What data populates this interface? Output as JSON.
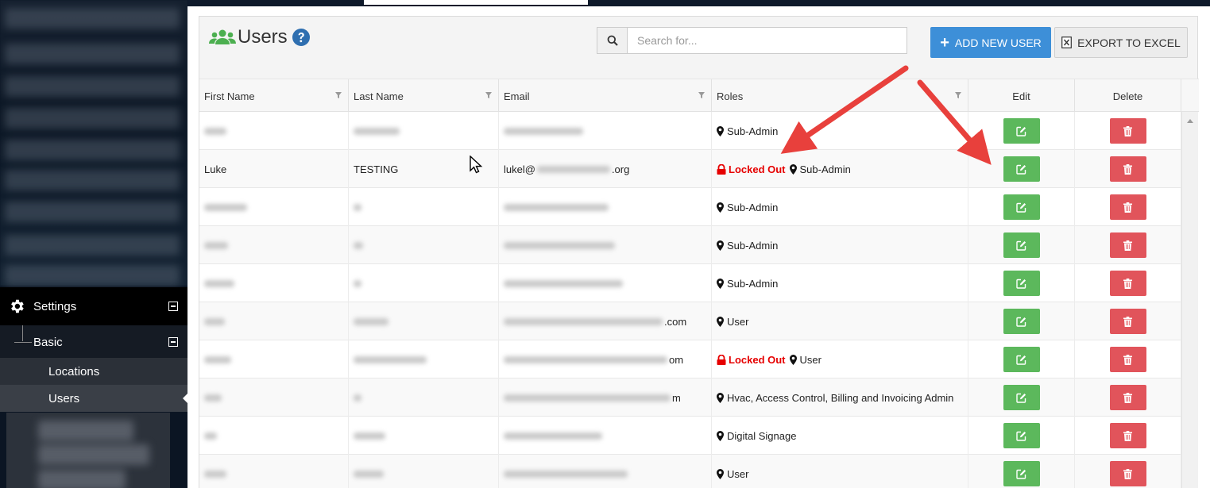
{
  "sidebar": {
    "settings_label": "Settings",
    "basic_label": "Basic",
    "locations_label": "Locations",
    "users_label": "Users"
  },
  "header": {
    "title": "Users",
    "search_placeholder": "Search for...",
    "add_button_label": "ADD NEW USER",
    "export_button_label": "EXPORT TO EXCEL"
  },
  "table": {
    "columns": {
      "first_name": "First Name",
      "last_name": "Last Name",
      "email": "Email",
      "roles": "Roles",
      "edit": "Edit",
      "delete": "Delete"
    },
    "rows": [
      {
        "first": "",
        "last": "",
        "email_prefix": "",
        "email_suffix": "",
        "locked": false,
        "role": "Sub-Admin"
      },
      {
        "first": "Luke",
        "last": "TESTING",
        "email_prefix": "lukel@",
        "email_suffix": ".org",
        "locked": true,
        "role": "Sub-Admin"
      },
      {
        "first": "",
        "last": "",
        "email_prefix": "",
        "email_suffix": "",
        "locked": false,
        "role": "Sub-Admin"
      },
      {
        "first": "",
        "last": "",
        "email_prefix": "",
        "email_suffix": "",
        "locked": false,
        "role": "Sub-Admin"
      },
      {
        "first": "",
        "last": "",
        "email_prefix": "",
        "email_suffix": "",
        "locked": false,
        "role": "Sub-Admin"
      },
      {
        "first": "",
        "last": "",
        "email_prefix": "",
        "email_suffix": ".com",
        "locked": false,
        "role": "User"
      },
      {
        "first": "",
        "last": "",
        "email_prefix": "",
        "email_suffix": "om",
        "locked": true,
        "role": "User"
      },
      {
        "first": "",
        "last": "",
        "email_prefix": "",
        "email_suffix": "m",
        "locked": false,
        "role": "Hvac, Access Control, Billing and Invoicing Admin"
      },
      {
        "first": "",
        "last": "",
        "email_prefix": "",
        "email_suffix": "",
        "locked": false,
        "role": "Digital Signage"
      },
      {
        "first": "",
        "last": "",
        "email_prefix": "",
        "email_suffix": "",
        "locked": false,
        "role": "User"
      }
    ],
    "locked_label": "Locked Out"
  },
  "colors": {
    "add_button": "#3d8fd8",
    "edit_button": "#5cb85c",
    "delete_button": "#e1545b",
    "locked_text": "#e60000",
    "annotation_arrow": "#e8403c",
    "users_icon": "#4caf50",
    "help_icon": "#2f6fb0"
  },
  "icons": {
    "search": "search-icon",
    "users": "users-icon",
    "help": "help-circle-icon",
    "add": "plus-icon",
    "excel": "excel-icon",
    "gear": "gear-icon",
    "filter": "filter-icon",
    "pin": "map-pin-icon",
    "lock": "lock-icon",
    "edit": "edit-icon",
    "delete": "trash-icon"
  }
}
